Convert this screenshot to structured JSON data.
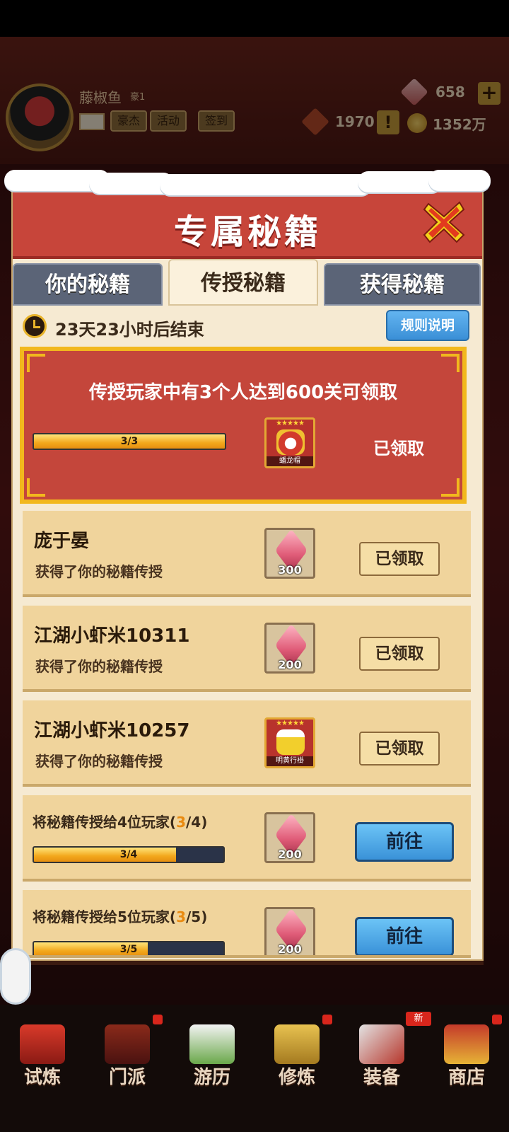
{
  "player": {
    "name": "藤椒鱼",
    "rank": "豪1",
    "buttons": [
      "豪杰",
      "活动",
      "签到"
    ]
  },
  "resources": {
    "gems": "658",
    "honor": "1970",
    "coins": "1352万"
  },
  "modal": {
    "title": "专属秘籍",
    "tabs": [
      "你的秘籍",
      "传授秘籍",
      "获得秘籍"
    ],
    "active_tab": "传授秘籍",
    "timer": "23天23小时后结束",
    "rules_button": "规则说明",
    "main_quest": {
      "title": "传授玩家中有3个人达到600关可领取",
      "progress_label": "3/3",
      "progress": 1.0,
      "reward_name": "蟠龙帽",
      "status": "已领取"
    },
    "rows": [
      {
        "name": "庞于晏",
        "sub": "获得了你的秘籍传授",
        "reward_qty": "300",
        "status": "已领取"
      },
      {
        "name": "江湖小虾米10311",
        "sub": "获得了你的秘籍传授",
        "reward_qty": "200",
        "status": "已领取"
      },
      {
        "name": "江湖小虾米10257",
        "sub": "获得了你的秘籍传授",
        "reward_name": "明黄行褂",
        "status": "已领取"
      }
    ],
    "tasks": [
      {
        "prefix": "将秘籍传授给4位玩家(",
        "current": "3",
        "suffix": "/4)",
        "progress_label": "3/4",
        "progress": 0.75,
        "reward_qty": "200",
        "button": "前往"
      },
      {
        "prefix": "将秘籍传授给5位玩家(",
        "current": "3",
        "suffix": "/5)",
        "progress_label": "3/5",
        "progress": 0.6,
        "reward_qty": "200",
        "button": "前往"
      }
    ]
  },
  "nav": {
    "items": [
      "试炼",
      "门派",
      "游历",
      "修炼",
      "装备",
      "商店"
    ],
    "new_badge": "新"
  },
  "colors": {
    "header_red": "#c7453a",
    "gold_border": "#f2b81d",
    "panel_bg": "#f6ead2",
    "row_bg": "#f0d49c",
    "button_blue": "#3a92d8",
    "highlight_orange": "#e98a10"
  }
}
